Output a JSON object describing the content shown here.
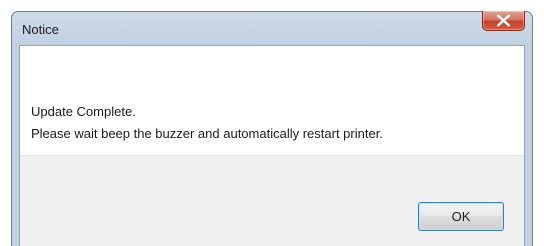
{
  "window": {
    "title": "Notice"
  },
  "message": {
    "line1": "Update Complete.",
    "line2": "Please wait beep the buzzer and automatically restart printer."
  },
  "buttons": {
    "ok_label": "OK"
  },
  "icons": {
    "close": "close-icon"
  },
  "colors": {
    "close_button": "#c74a31",
    "ok_border": "#3c7fb1"
  }
}
